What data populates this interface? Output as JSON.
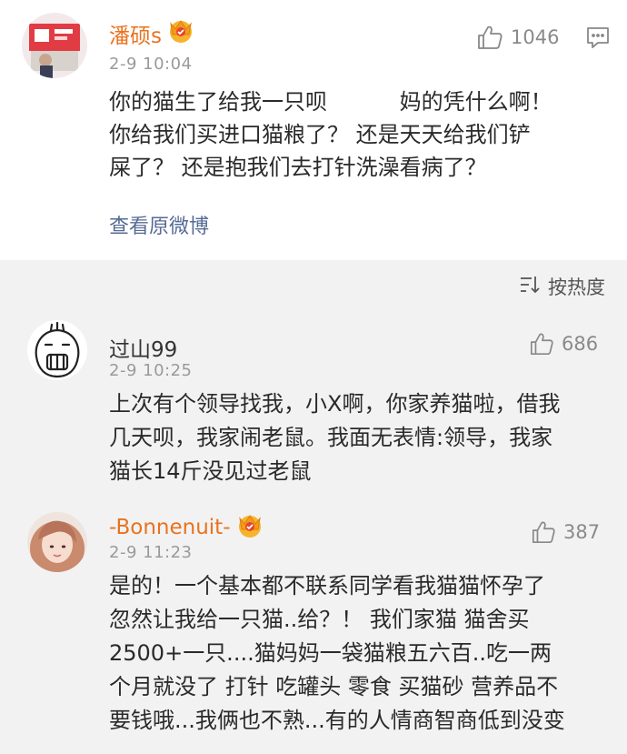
{
  "post": {
    "author": "潘硕s",
    "time": "2-9 10:04",
    "likes": "1046",
    "text": "你的猫生了给我一只呗 　　　妈的凭什么啊！\n你给我们买进口猫粮了？ 还是天天给我们铲\n屎了？ 还是抱我们去打针洗澡看病了？",
    "view_original": "查看原微博",
    "icons": {
      "like": "thumbs-up-icon",
      "comment": "comment-icon",
      "badge": "crown-badge-icon"
    }
  },
  "sort": {
    "label": "按热度",
    "icon": "sort-icon"
  },
  "comments": [
    {
      "author": "过山99",
      "time": "2-9 10:25",
      "likes": "686",
      "text": "上次有个领导找我，小X啊，你家养猫啦，借我\n几天呗，我家闹老鼠。我面无表情:领导，我家\n猫长14斤没见过老鼠"
    },
    {
      "author": "-Bonnenuit-",
      "time": "2-9 11:23",
      "likes": "387",
      "text": "是的！一个基本都不联系同学看我猫猫怀孕了\n忽然让我给一只猫..给？！ 我们家猫 猫舍买\n2500+一只....猫妈妈一袋猫粮五六百..吃一两\n个月就没了 打针 吃罐头 零食 买猫砂 营养品不\n要钱哦...我俩也不熟...有的人情商智商低到没变"
    }
  ],
  "colors": {
    "name_accent": "#e8731f",
    "link": "#576b95",
    "comment_bg": "#f2f2f2",
    "meta": "#9a9a9a"
  }
}
